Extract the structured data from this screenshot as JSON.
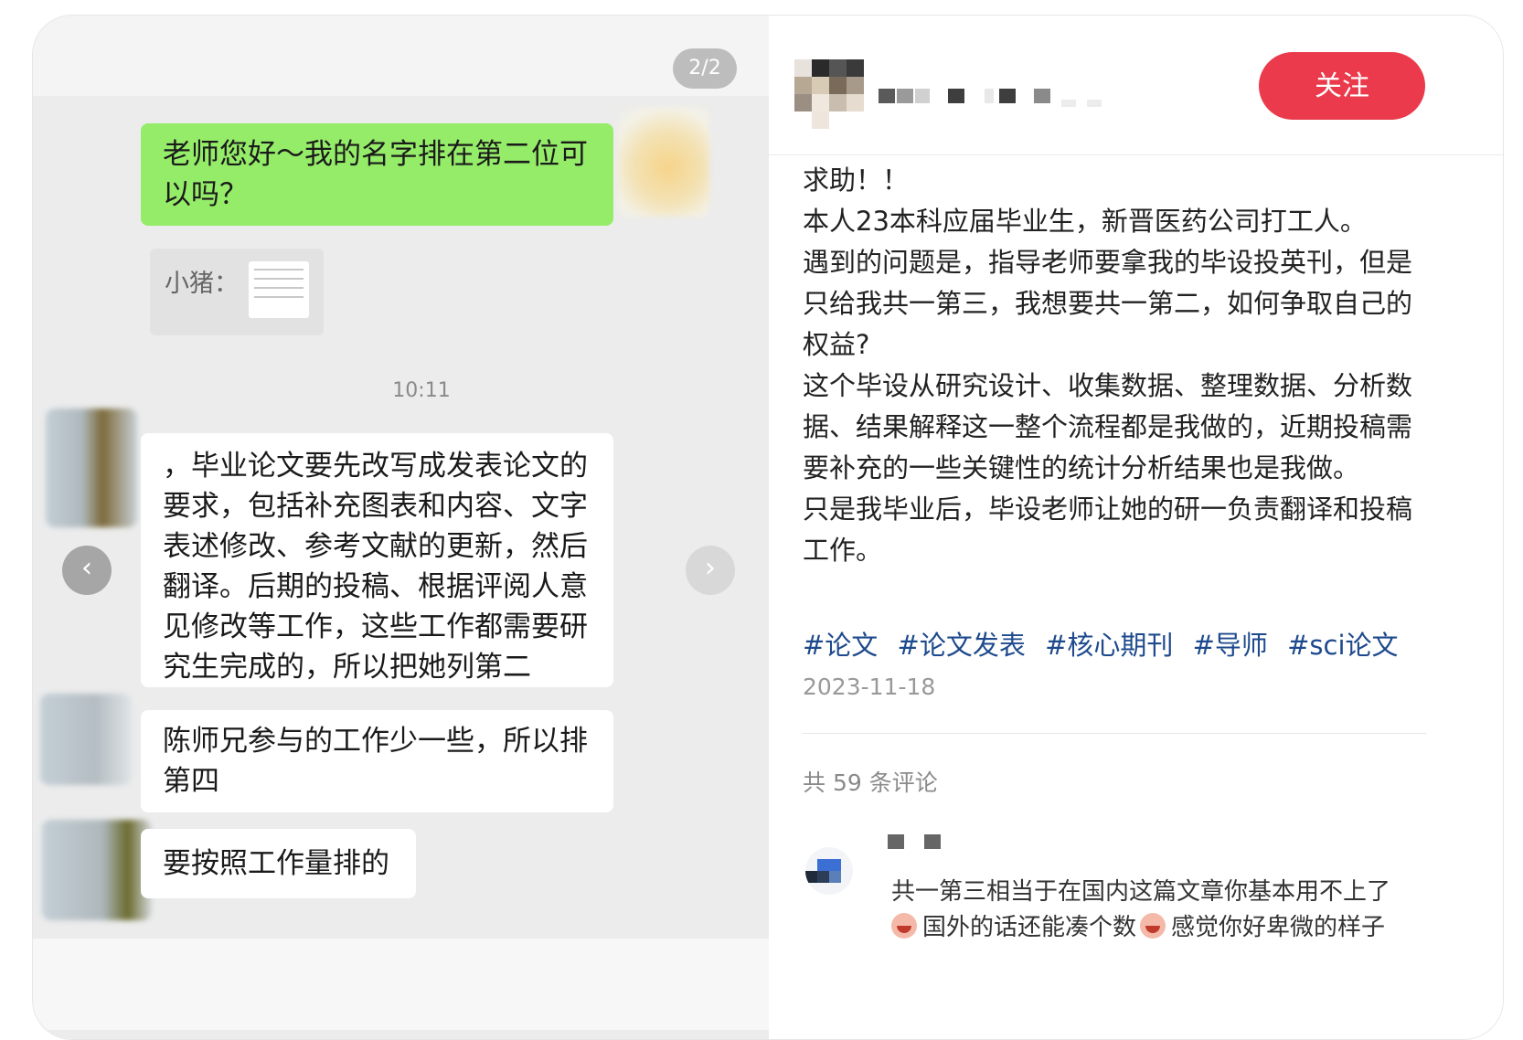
{
  "carousel": {
    "counter": "2/2",
    "prev_icon": "chevron-left-icon",
    "next_icon": "chevron-right-icon",
    "chat": {
      "msg1": "老师您好～我的名字排在第二位可以吗？",
      "quote_label": "小猪：",
      "time": "10:11",
      "msg2": "，毕业论文要先改写成发表论文的要求，包括补充图表和内容、文字表述修改、参考文献的更新，然后翻译。后期的投稿、根据评阅人意见修改等工作，这些工作都需要研究生完成的，所以把她列第二",
      "msg3": "陈师兄参与的工作少一些，所以排第四",
      "msg4": "要按照工作量排的"
    }
  },
  "author": {
    "follow_label": "关注"
  },
  "post": {
    "lines": [
      "求助！！",
      "本人23本科应届毕业生，新晋医药公司打工人。",
      "遇到的问题是，指导老师要拿我的毕设投英刊，但是只给我共一第三，我想要共一第二，如何争取自己的权益?",
      "这个毕设从研究设计、收集数据、整理数据、分析数据、结果解释这一整个流程都是我做的，近期投稿需要补充的一些关键性的统计分析结果也是我做。",
      "只是我毕业后，毕设老师让她的研一负责翻译和投稿工作。"
    ],
    "tags": [
      "#论文",
      "#论文发表",
      "#核心期刊",
      "#导师",
      "#sci论文"
    ],
    "date": "2023-11-18"
  },
  "comments": {
    "count_label": "共 59 条评论",
    "items": [
      {
        "text_part1": "共一第三相当于在国内这篇文章你基本用不上了",
        "text_part2": "国外的话还能凑个数",
        "text_part3": "感觉你好卑微的样子"
      }
    ]
  },
  "colors": {
    "follow_button": "#ea3a4b",
    "tag": "#1e4a8d",
    "chat_green": "#95ec69"
  }
}
